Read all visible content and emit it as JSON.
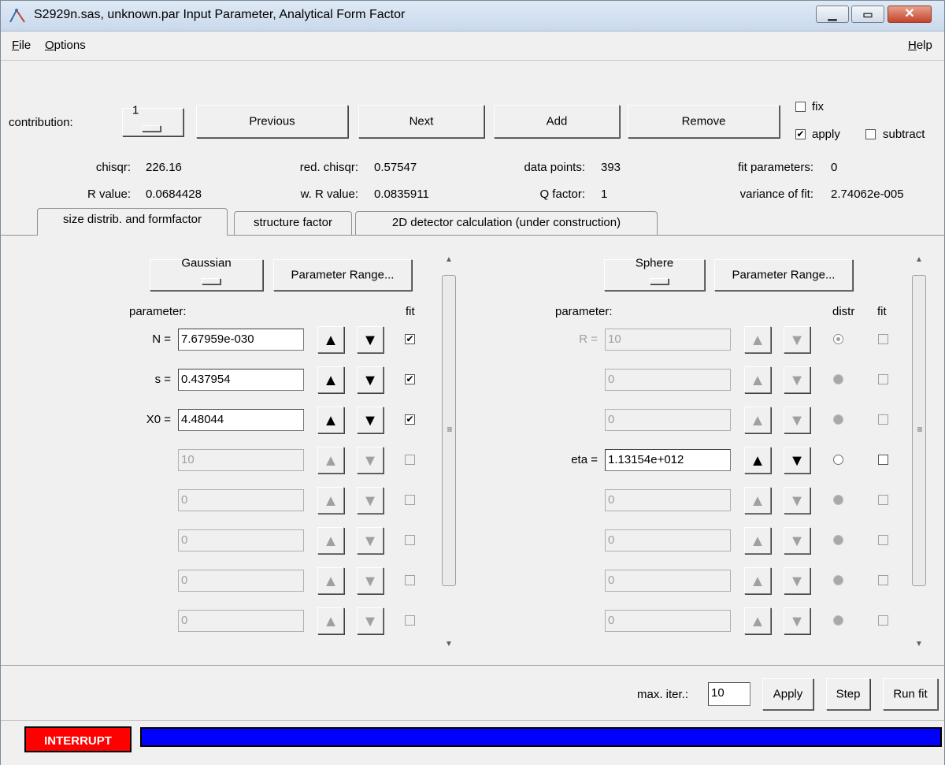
{
  "window": {
    "title": "S2929n.sas, unknown.par Input Parameter, Analytical Form Factor",
    "controls": {
      "minimize_icon": "minimize-icon",
      "maximize_icon": "maximize-icon",
      "close_icon": "close-icon"
    }
  },
  "menu": {
    "file_first": "F",
    "file_rest": "ile",
    "options_first": "O",
    "options_rest": "ptions",
    "help_first": "H",
    "help_rest": "elp"
  },
  "toolbar": {
    "contribution_label": "contribution:",
    "contribution_value": "1",
    "previous": "Previous",
    "next": "Next",
    "add": "Add",
    "remove": "Remove",
    "fix_label": "fix",
    "fix_checked": false,
    "apply_label": "apply",
    "apply_checked": true,
    "subtract_label": "subtract",
    "subtract_checked": false
  },
  "stats": {
    "chisqr_label": "chisqr:",
    "chisqr": "226.16",
    "red_chisqr_label": "red. chisqr:",
    "red_chisqr": "0.57547",
    "data_points_label": "data points:",
    "data_points": "393",
    "fit_parameters_label": "fit parameters:",
    "fit_parameters": "0",
    "r_value_label": "R value:",
    "r_value": "0.0684428",
    "w_r_value_label": "w. R value:",
    "w_r_value": "0.0835911",
    "q_factor_label": "Q factor:",
    "q_factor": "1",
    "variance_label": "variance of fit:",
    "variance": "2.74062e-005"
  },
  "tabs": [
    {
      "label": "size distrib. and formfactor",
      "active": true
    },
    {
      "label": "structure factor",
      "active": false
    },
    {
      "label": "2D detector calculation (under construction)",
      "active": false
    }
  ],
  "size_distrib": {
    "type": "Gaussian",
    "param_range": "Parameter Range...",
    "parameter_header": "parameter:",
    "fit_header": "fit",
    "rows": [
      {
        "label": "N =",
        "value": "7.67959e-030",
        "fit": true,
        "enabled": true
      },
      {
        "label": "s =",
        "value": "0.437954",
        "fit": true,
        "enabled": true
      },
      {
        "label": "X0 =",
        "value": "4.48044",
        "fit": true,
        "enabled": true
      },
      {
        "label": "",
        "value": "10",
        "fit": false,
        "enabled": false
      },
      {
        "label": "",
        "value": "0",
        "fit": false,
        "enabled": false
      },
      {
        "label": "",
        "value": "0",
        "fit": false,
        "enabled": false
      },
      {
        "label": "",
        "value": "0",
        "fit": false,
        "enabled": false
      },
      {
        "label": "",
        "value": "0",
        "fit": false,
        "enabled": false
      }
    ]
  },
  "form_factor": {
    "type": "Sphere",
    "param_range": "Parameter Range...",
    "parameter_header": "parameter:",
    "distr_header": "distr",
    "fit_header": "fit",
    "rows": [
      {
        "label": "R =",
        "value": "10",
        "enabled": false,
        "distr": "selected-disabled"
      },
      {
        "label": "",
        "value": "0",
        "enabled": false,
        "distr": "disabled"
      },
      {
        "label": "",
        "value": "0",
        "enabled": false,
        "distr": "disabled"
      },
      {
        "label": "eta =",
        "value": "1.13154e+012",
        "enabled": true,
        "distr": "empty"
      },
      {
        "label": "",
        "value": "0",
        "enabled": false,
        "distr": "disabled"
      },
      {
        "label": "",
        "value": "0",
        "enabled": false,
        "distr": "disabled"
      },
      {
        "label": "",
        "value": "0",
        "enabled": false,
        "distr": "disabled"
      },
      {
        "label": "",
        "value": "0",
        "enabled": false,
        "distr": "disabled"
      }
    ]
  },
  "bottom": {
    "max_iter_label": "max. iter.:",
    "max_iter": "10",
    "apply": "Apply",
    "step": "Step",
    "run_fit": "Run fit"
  },
  "status": {
    "interrupt": "INTERRUPT",
    "progress_fraction": 1.0,
    "interrupt_color": "#ff0000",
    "progress_color": "#0000ff"
  },
  "glyphs": {
    "check": "✔",
    "up": "▲",
    "down": "▼",
    "scroll_up": "▲",
    "scroll_down": "▼",
    "grip": "≡"
  }
}
